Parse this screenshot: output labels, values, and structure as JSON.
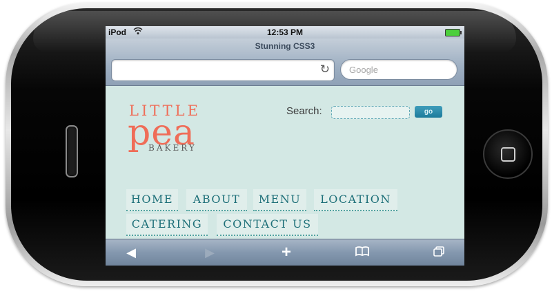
{
  "status_bar": {
    "carrier": "iPod",
    "time": "12:53 PM"
  },
  "browser": {
    "page_title": "Stunning CSS3",
    "url_value": "",
    "search_placeholder": "Google"
  },
  "site": {
    "logo_little": "LITTLE",
    "logo_pea": "pea",
    "logo_bakery": "BAKERY",
    "search_label": "Search:",
    "search_button": "go",
    "nav": [
      "HOME",
      "ABOUT",
      "MENU",
      "LOCATION",
      "CATERING",
      "CONTACT US"
    ]
  },
  "colors": {
    "background": "#d3e8e4",
    "logo_accent": "#ef6d58",
    "nav_text": "#1d6f78",
    "button": "#1c7b9b"
  },
  "icons": [
    "wifi-icon",
    "battery-icon",
    "reload-icon",
    "back-icon",
    "forward-icon",
    "add-bookmark-icon",
    "bookmarks-icon",
    "pages-icon"
  ]
}
